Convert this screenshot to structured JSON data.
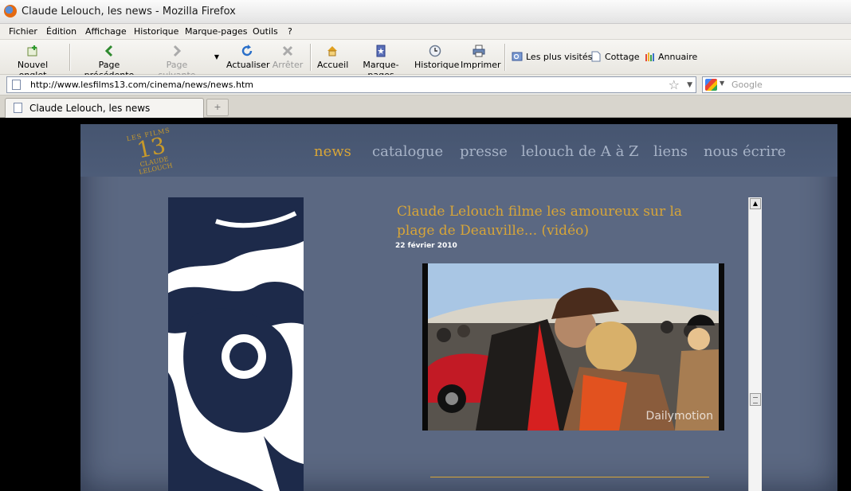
{
  "window": {
    "title": "Claude Lelouch, les news - Mozilla Firefox"
  },
  "menu": [
    "Fichier",
    "Édition",
    "Affichage",
    "Historique",
    "Marque-pages",
    "Outils",
    "?"
  ],
  "toolbar": {
    "new_tab": "Nouvel onglet",
    "back": "Page précédente",
    "forward": "Page suivante",
    "reload": "Actualiser",
    "stop": "Arrêter",
    "home": "Accueil",
    "bookmarks": "Marque-pages",
    "history": "Historique",
    "print": "Imprimer"
  },
  "bookmarks_bar": [
    "Les plus visités",
    "Cottage",
    "Annuaire"
  ],
  "navbar": {
    "url": "http://www.lesfilms13.com/cinema/news/news.htm",
    "search_placeholder": "Google"
  },
  "tabs": [
    {
      "label": "Claude Lelouch, les news",
      "active": true
    }
  ],
  "site": {
    "logo": {
      "top": "LES FILMS",
      "number": "13",
      "bottom1": "CLAUDE",
      "bottom2": "LELOUCH"
    },
    "nav": [
      "news",
      "catalogue",
      "presse",
      "lelouch de A à Z",
      "liens",
      "nous écrire"
    ],
    "active_nav": "news",
    "article": {
      "title": "Claude Lelouch filme les amoureux sur la plage de Deauville... (vidéo)",
      "date": "22 février 2010",
      "video_watermark": "Dailymotion"
    },
    "colors": {
      "accent": "#d7a538",
      "panel": "#5b6882",
      "header": "#4d5c78"
    }
  }
}
